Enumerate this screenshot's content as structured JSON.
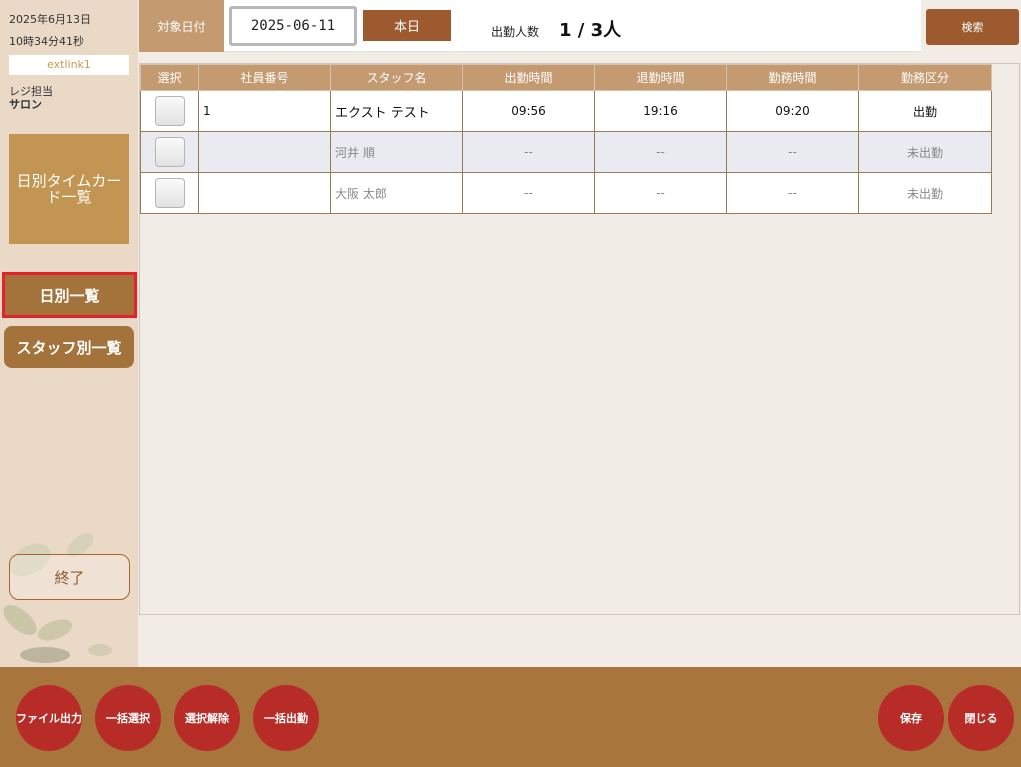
{
  "sidebar": {
    "date": "2025年6月13日",
    "time": "10時34分41秒",
    "user": "extlink1",
    "role_label": "レジ担当",
    "role_value": "サロン",
    "page_title": "日別タイムカード一覧",
    "nav_daily": "日別一覧",
    "nav_staff": "スタッフ別一覧",
    "exit": "終了"
  },
  "header": {
    "target_date_label": "対象日付",
    "target_date_value": "2025-06-11",
    "today_button": "本日",
    "attendance_label": "出勤人数",
    "attendance_value": "1 / 3人",
    "search_button": "検索"
  },
  "table": {
    "columns": [
      "選択",
      "社員番号",
      "スタッフ名",
      "出勤時間",
      "退勤時間",
      "勤務時間",
      "勤務区分"
    ],
    "rows": [
      {
        "id": "1",
        "name": "エクスト テスト",
        "in": "09:56",
        "out": "19:16",
        "hours": "09:20",
        "status": "出勤"
      },
      {
        "id": "",
        "name": "河井 順",
        "in": "--",
        "out": "--",
        "hours": "--",
        "status": "未出勤"
      },
      {
        "id": "",
        "name": "大阪 太郎",
        "in": "--",
        "out": "--",
        "hours": "--",
        "status": "未出勤"
      }
    ]
  },
  "footer": {
    "file_output": "ファイル出力",
    "select_all": "一括選択",
    "deselect": "選択解除",
    "bulk_clock_in": "一括出勤",
    "save": "保存",
    "close": "閉じる"
  },
  "colors": {
    "sidebar_bg": "#ead9c6",
    "accent_brown": "#a3733b",
    "header_label": "#c49a70",
    "button_red": "#b82c27",
    "highlight_border": "#e8202a"
  }
}
